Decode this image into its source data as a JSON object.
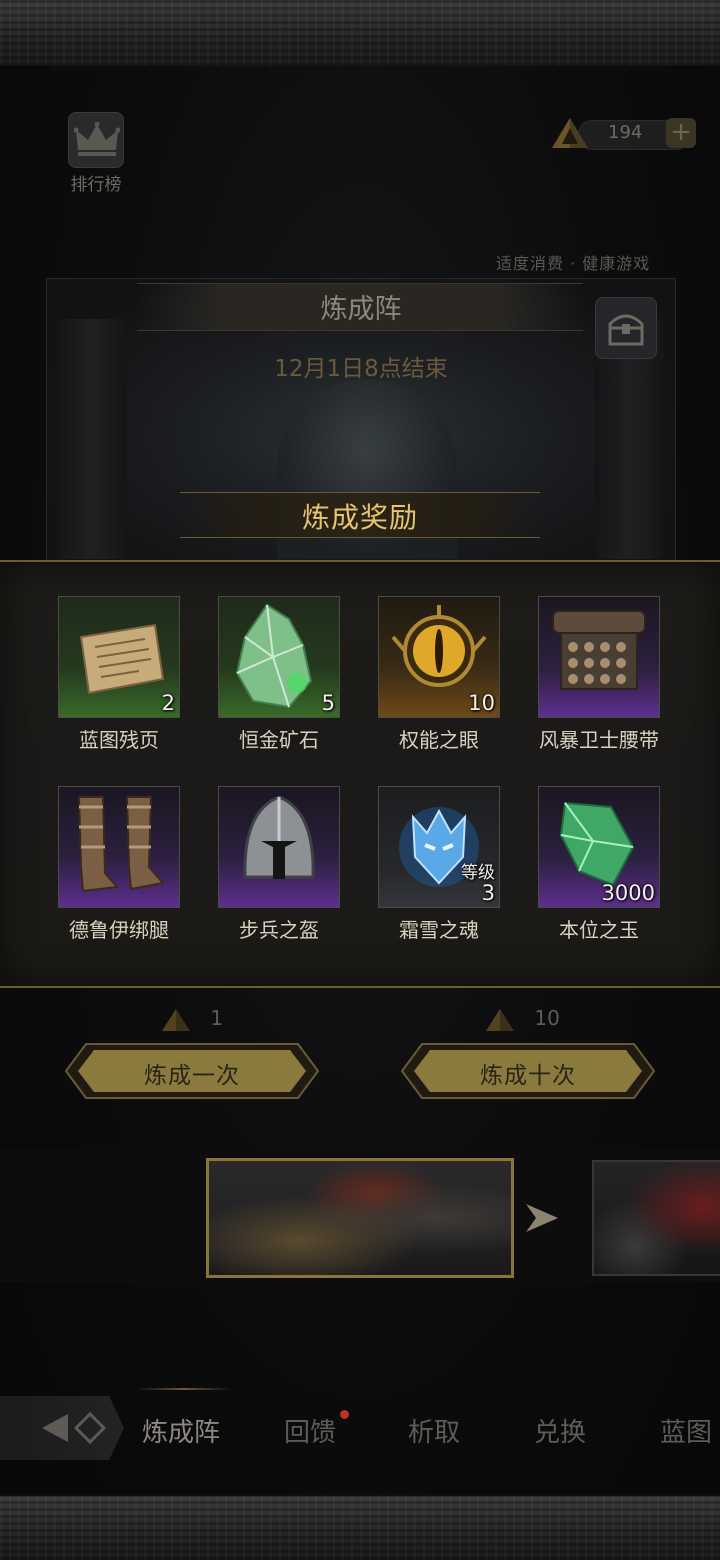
{
  "header": {
    "ranking_label": "排行榜",
    "currency_value": "194",
    "currency_add": "+",
    "tagline": "适度消费 · 健康游戏"
  },
  "event": {
    "title": "炼成阵",
    "timer": "12月1日8点结束"
  },
  "rewards": {
    "title": "炼成奖励",
    "items": [
      {
        "name": "蓝图残页",
        "count": "2",
        "rarity": "green",
        "icon": "blueprint-scroll-icon"
      },
      {
        "name": "恒金矿石",
        "count": "5",
        "rarity": "green",
        "icon": "ore-crystal-icon"
      },
      {
        "name": "权能之眼",
        "count": "10",
        "rarity": "gold",
        "icon": "golden-eye-icon"
      },
      {
        "name": "风暴卫士腰带",
        "count": "",
        "rarity": "purple",
        "icon": "belt-icon"
      },
      {
        "name": "德鲁伊绑腿",
        "count": "",
        "rarity": "purple",
        "icon": "leggings-icon"
      },
      {
        "name": "步兵之盔",
        "count": "",
        "rarity": "purple",
        "icon": "helmet-icon"
      },
      {
        "name": "霜雪之魂",
        "count": "3",
        "level_label": "等级",
        "rarity": "gray",
        "icon": "frost-soul-icon"
      },
      {
        "name": "本位之玉",
        "count": "3000",
        "rarity": "purple",
        "icon": "jade-gem-icon"
      }
    ]
  },
  "draw": {
    "single": {
      "cost": "1",
      "label": "炼成一次"
    },
    "ten": {
      "cost": "10",
      "label": "炼成十次"
    }
  },
  "nav": {
    "tabs": [
      "炼成阵",
      "回馈",
      "析取",
      "兑换",
      "蓝图"
    ],
    "active": "炼成阵"
  },
  "colors": {
    "accent_gold": "#e7c56c",
    "button_gold": "#c9ae55",
    "rarity_green": "#3a6a2a",
    "rarity_gold": "#6d4a18",
    "rarity_purple": "#5c2f8e",
    "badge_red": "#c0302b"
  }
}
